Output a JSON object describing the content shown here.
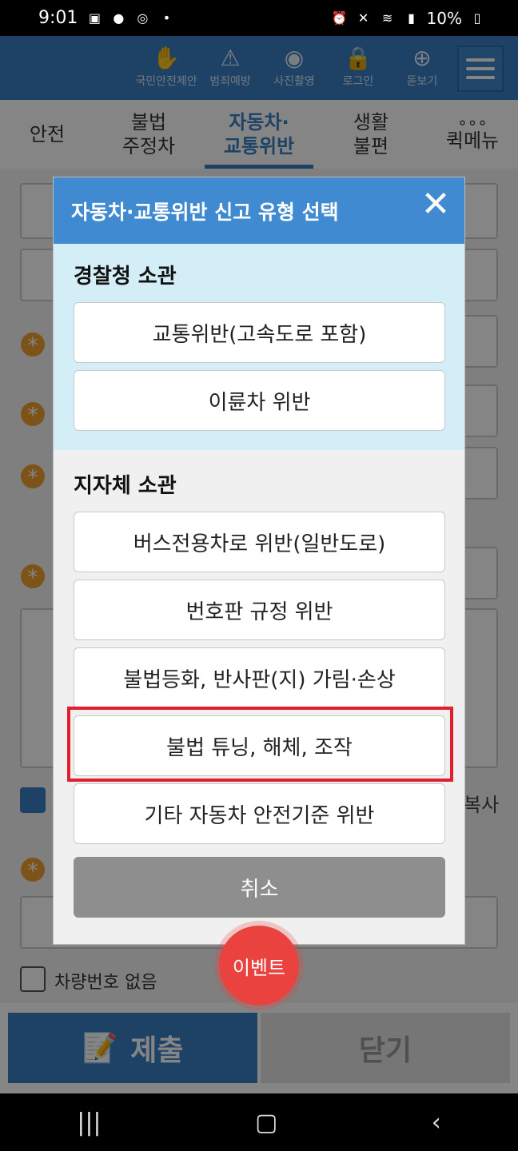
{
  "status_bar": {
    "time": "9:01",
    "battery": "10%"
  },
  "toolbar": {
    "tools": [
      {
        "label": "국민안전제안",
        "icon": "hand-shield-icon"
      },
      {
        "label": "범죄예방",
        "icon": "siren-icon"
      },
      {
        "label": "사진촬영",
        "icon": "camera-icon"
      },
      {
        "label": "로그인",
        "icon": "lock-icon"
      },
      {
        "label": "돋보기",
        "icon": "magnifier-icon"
      }
    ]
  },
  "tabs": [
    {
      "label": "안전"
    },
    {
      "label": "불법\n주정차"
    },
    {
      "label": "자동차·\n교통위반"
    },
    {
      "label": "생활\n불편"
    },
    {
      "label": "퀵메뉴"
    }
  ],
  "background": {
    "car_number_none": "차량번호 없음",
    "copy_partial": "복사"
  },
  "bottom": {
    "submit": "제출",
    "close": "닫기"
  },
  "modal": {
    "title": "자동차·교통위반 신고 유형 선택",
    "police_section": {
      "title": "경찰청 소관",
      "options": [
        "교통위반(고속도로 포함)",
        "이륜차 위반"
      ]
    },
    "local_section": {
      "title": "지자체 소관",
      "options": [
        "버스전용차로 위반(일반도로)",
        "번호판 규정 위반",
        "불법등화, 반사판(지) 가림·손상",
        "불법 튜닝, 해체, 조작",
        "기타 자동차 안전기준 위반"
      ]
    },
    "cancel": "취소"
  },
  "event_button": "이벤트"
}
